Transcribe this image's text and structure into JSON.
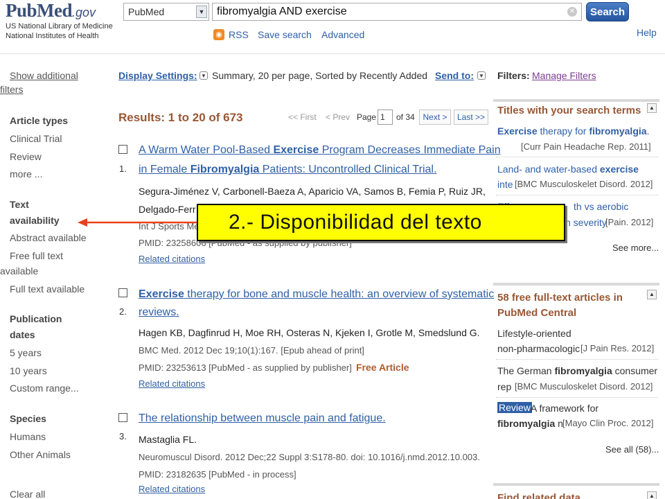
{
  "header": {
    "logo_main": "PubMed",
    "logo_gov": ".gov",
    "nlm_line1": "US National Library of Medicine",
    "nlm_line2": "National Institutes of Health",
    "database_selected": "PubMed",
    "search_query": "fibromyalgia AND exercise",
    "search_button": "Search",
    "rss": "RSS",
    "save_search": "Save search",
    "advanced": "Advanced",
    "help": "Help"
  },
  "sidebar": {
    "show_additional_1": "Show additional",
    "show_additional_2": "filters",
    "article_types_heading": "Article types",
    "article_types": [
      "Clinical Trial",
      "Review",
      "more ..."
    ],
    "text_availability_heading_1": "Text",
    "text_availability_heading_2": "availability",
    "text_availability": [
      "Abstract available",
      "Free full text",
      "available",
      "Full text available"
    ],
    "publication_dates_heading_1": "Publication",
    "publication_dates_heading_2": "dates",
    "publication_dates": [
      "5 years",
      "10 years",
      "Custom range..."
    ],
    "species_heading": "Species",
    "species": [
      "Humans",
      "Other Animals"
    ],
    "clear_all": "Clear all"
  },
  "main": {
    "display_settings_label": "Display Settings:",
    "display_settings_value": "Summary, 20 per page, Sorted by Recently Added",
    "send_to": "Send to:",
    "results_count": "Results: 1 to 20 of 673",
    "pager": {
      "first": "<< First",
      "prev": "< Prev",
      "page_label": "Page",
      "page_value": "1",
      "of_pages": "of 34",
      "next": "Next >",
      "last": "Last >>"
    },
    "results": [
      {
        "number": "1.",
        "title_1a": "A Warm Water Pool-Based ",
        "title_1b": "Exercise",
        "title_1c": " Program Decreases Immediate Pain",
        "title_2a": "in Female ",
        "title_2b": "Fibromyalgia",
        "title_2c": " Patients: Uncontrolled Clinical Trial.",
        "authors_1": "Segura-Jiménez V, Carbonell-Baeza A, Aparicio VA, Samos B, Femia P, Ruiz JR,",
        "authors_2": "Delgado-Ferr",
        "journal": "Int J Sports Me",
        "pmid": "PMID: 23258606 [PubMed - as supplied by publisher]",
        "related": "Related citations"
      },
      {
        "number": "2.",
        "title_1a": "Exercise",
        "title_1b": " therapy for bone and muscle health: an overview of systematic",
        "title_2": "reviews.",
        "authors": "Hagen KB, Dagfinrud H, Moe RH, Osteras N, Kjeken I, Grotle M, Smedslund G.",
        "journal": "BMC Med. 2012 Dec 19;10(1):167. [Epub ahead of print]",
        "pmid": "PMID: 23253613 [PubMed - as supplied by publisher]",
        "free": "Free Article",
        "related": "Related citations"
      },
      {
        "number": "3.",
        "title": "The relationship between muscle pain and fatigue.",
        "authors": "Mastaglia FL.",
        "journal": "Neuromuscul Disord. 2012 Dec;22 Suppl 3:S178-80. doi: 10.1016/j.nmd.2012.10.003.",
        "pmid": "PMID: 23182635 [PubMed - in process]",
        "related": "Related citations"
      }
    ]
  },
  "right": {
    "filters_label": "Filters:",
    "manage_filters": "Manage Filters",
    "titles_box": {
      "title": "Titles with your search terms",
      "item1_a": "Exercise",
      "item1_b": " therapy for ",
      "item1_c": "fibromyalgia",
      "item1_d": ".",
      "item1_src": "[Curr Pain Headache Rep. 2011]",
      "item2_a": "Land- and water-based ",
      "item2_b": "exercise",
      "item2_c": "inte",
      "item2_src": "[BMC Musculoskelet Disord. 2012]",
      "item3_a": "Eff",
      "item3_b": "th vs aerobic",
      "item3_c": "n severity",
      "item3_src": "[Pain. 2012]",
      "see_more": "See more..."
    },
    "free_box": {
      "title_1": "58 free full-text articles in",
      "title_2": "PubMed Central",
      "item1_a": "Lifestyle-oriented",
      "item1_b": "non-pharmacologic",
      "item1_src": "[J Pain Res. 2012]",
      "item2_a": "The German ",
      "item2_b": "fibromyalgia",
      "item2_c": " consumer",
      "item2_d": "rep",
      "item2_src": "[BMC Musculoskelet Disord. 2012]",
      "review_badge": "Review",
      "item3_a": " A framework for",
      "item3_b": "fibromyalgia",
      "item3_c": " n",
      "item3_src": "[Mayo Clin Proc. 2012]",
      "see_all": "See all (58)..."
    },
    "find_related": "Find related data"
  },
  "annotation": {
    "text": "2.- Disponibilidad  del texto",
    "color": "#ffff00",
    "arrow_color": "#e8401c"
  }
}
